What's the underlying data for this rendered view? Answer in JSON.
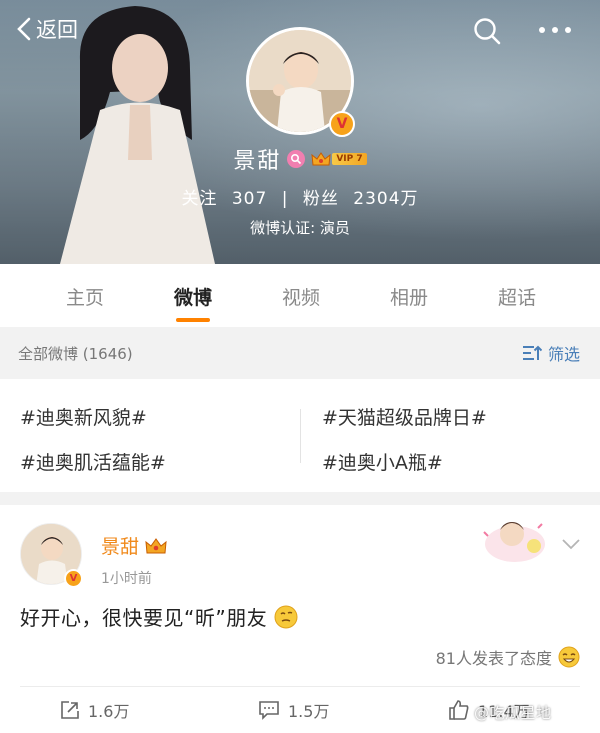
{
  "header": {
    "back_label": "返回",
    "name": "景甜",
    "vip_label": "VIP 7",
    "following_label": "关注",
    "following_count": "307",
    "stat_separator": "|",
    "followers_label": "粉丝",
    "followers_count": "2304万",
    "certification": "微博认证: 演员"
  },
  "tabs": [
    {
      "label": "主页",
      "active": false
    },
    {
      "label": "微博",
      "active": true
    },
    {
      "label": "视频",
      "active": false
    },
    {
      "label": "相册",
      "active": false
    },
    {
      "label": "超话",
      "active": false
    }
  ],
  "filter": {
    "all_label": "全部微博 (1646)",
    "sort_label": "筛选"
  },
  "topics": [
    "#迪奥新风貌#",
    "#天猫超级品牌日#",
    "#迪奥肌活蕴能#",
    "#迪奥小A瓶#"
  ],
  "post": {
    "author": "景甜",
    "time": "1小时前",
    "text": "好开心，很快要见“昕”朋友",
    "reactions": "81人发表了态度",
    "repost_count": "1.6万",
    "comment_count": "1.5万",
    "like_count": "11.4万"
  },
  "watermark": "@吃瓜星地",
  "colors": {
    "accent": "#ff8200",
    "author_name": "#f08a1c",
    "link_blue": "#4a7fb8",
    "vip_gold": "#f3a623"
  }
}
